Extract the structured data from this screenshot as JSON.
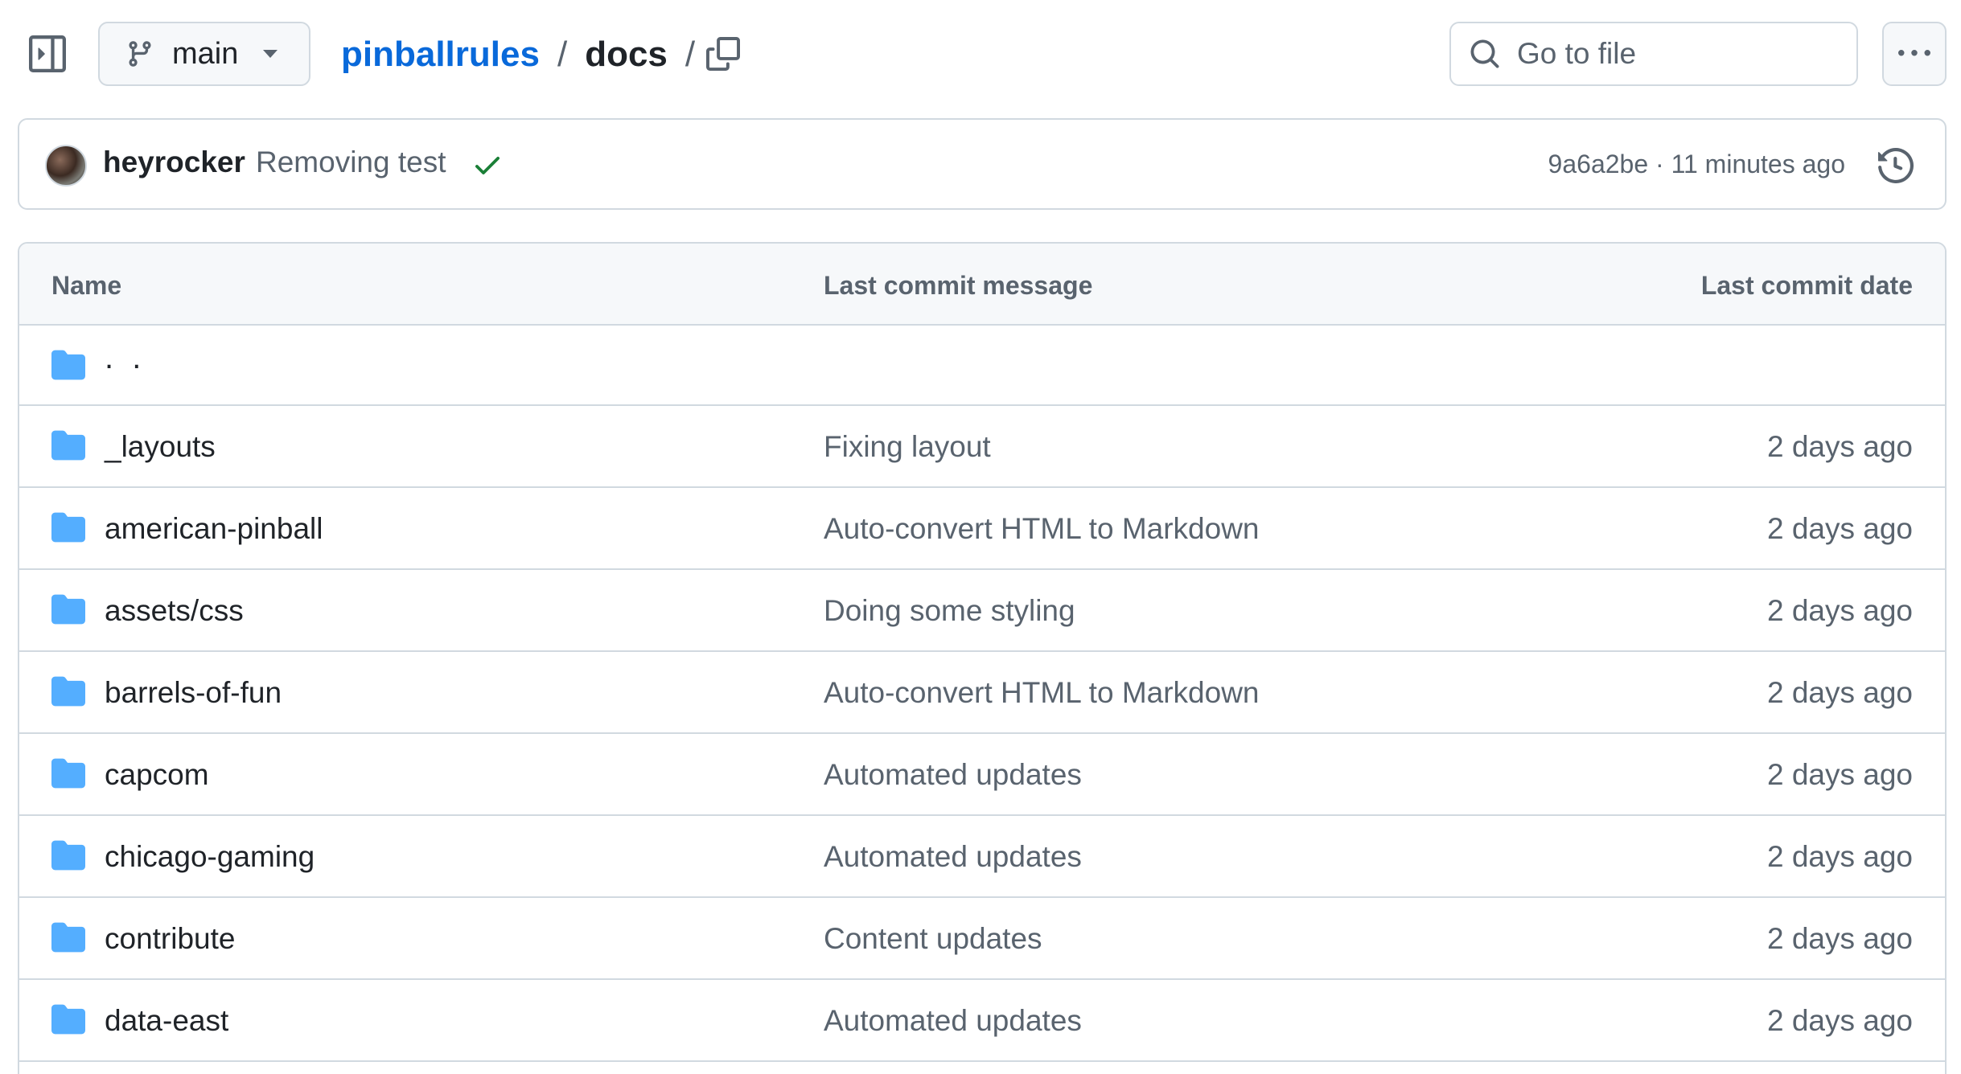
{
  "colors": {
    "link": "#0969da",
    "folder": "#54aeff",
    "success": "#1a7f37",
    "muted_text": "#59636e",
    "border": "#d1d9e0",
    "header_bg": "#f6f8fa"
  },
  "topbar": {
    "sidebar_toggle_icon": "sidebar-expand-icon",
    "branch": {
      "icon": "git-branch-icon",
      "name": "main",
      "caret_icon": "triangle-down-icon"
    },
    "breadcrumb": {
      "repo": "pinballrules",
      "separator": "/",
      "directory": "docs",
      "trailing_separator": "/"
    },
    "copy_path_icon": "copy-icon",
    "goto_file": {
      "icon": "search-icon",
      "placeholder": "Go to file"
    },
    "more_icon": "kebab-horizontal-icon"
  },
  "commit": {
    "author": "heyrocker",
    "message": "Removing test",
    "status_icon": "check-icon",
    "sha": "9a6a2be",
    "separator": "·",
    "time": "11 minutes ago",
    "history_icon": "history-icon"
  },
  "table": {
    "headers": {
      "name": "Name",
      "message": "Last commit message",
      "date": "Last commit date"
    },
    "parent": {
      "icon": "folder-icon",
      "name": ". ."
    },
    "rows": [
      {
        "icon": "folder-icon",
        "name": "_layouts",
        "message": "Fixing layout",
        "date": "2 days ago"
      },
      {
        "icon": "folder-icon",
        "name": "american-pinball",
        "message": "Auto-convert HTML to Markdown",
        "date": "2 days ago"
      },
      {
        "icon": "folder-icon",
        "name": "assets/css",
        "message": "Doing some styling",
        "date": "2 days ago"
      },
      {
        "icon": "folder-icon",
        "name": "barrels-of-fun",
        "message": "Auto-convert HTML to Markdown",
        "date": "2 days ago"
      },
      {
        "icon": "folder-icon",
        "name": "capcom",
        "message": "Automated updates",
        "date": "2 days ago"
      },
      {
        "icon": "folder-icon",
        "name": "chicago-gaming",
        "message": "Automated updates",
        "date": "2 days ago"
      },
      {
        "icon": "folder-icon",
        "name": "contribute",
        "message": "Content updates",
        "date": "2 days ago"
      },
      {
        "icon": "folder-icon",
        "name": "data-east",
        "message": "Automated updates",
        "date": "2 days ago"
      }
    ]
  }
}
